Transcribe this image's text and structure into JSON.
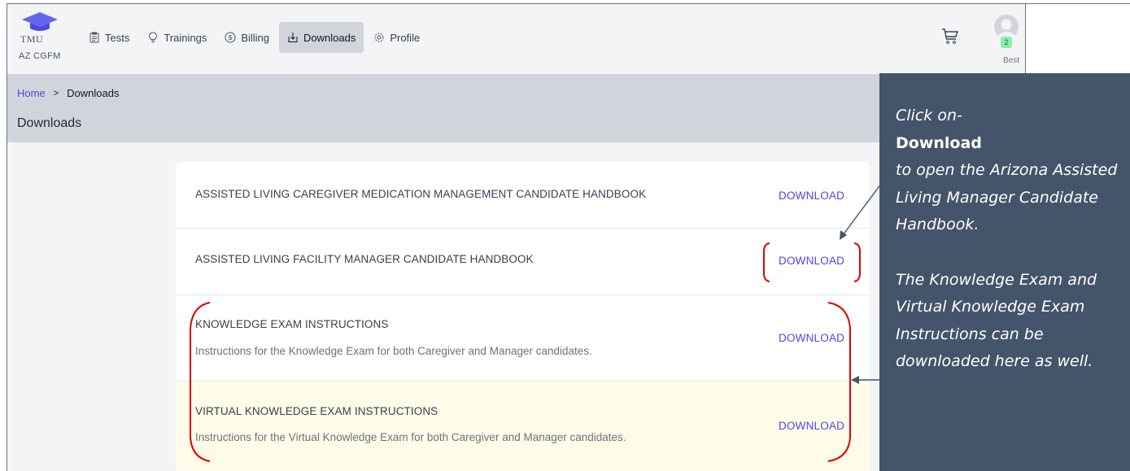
{
  "app": {
    "logo_text": "TMU",
    "logo_sub": "AZ CGFM"
  },
  "nav": {
    "items": [
      {
        "label": "Tests",
        "icon": "clipboard-icon",
        "active": false
      },
      {
        "label": "Trainings",
        "icon": "lightbulb-icon",
        "active": false
      },
      {
        "label": "Billing",
        "icon": "dollar-circle-icon",
        "active": false
      },
      {
        "label": "Downloads",
        "icon": "download-tray-icon",
        "active": true
      },
      {
        "label": "Profile",
        "icon": "gear-icon",
        "active": false
      }
    ]
  },
  "user": {
    "badge_count": "2",
    "name": "Best"
  },
  "breadcrumb": {
    "home": "Home",
    "separator": ">",
    "current": "Downloads"
  },
  "page": {
    "title": "Downloads"
  },
  "downloads": [
    {
      "title": "ASSISTED LIVING CAREGIVER MEDICATION MANAGEMENT CANDIDATE HANDBOOK",
      "desc": "",
      "action": "DOWNLOAD"
    },
    {
      "title": "ASSISTED LIVING FACILITY MANAGER CANDIDATE HANDBOOK",
      "desc": "",
      "action": "DOWNLOAD"
    },
    {
      "title": "KNOWLEDGE EXAM INSTRUCTIONS",
      "desc": "Instructions for the Knowledge Exam for both Caregiver and Manager candidates.",
      "action": "DOWNLOAD"
    },
    {
      "title": "VIRTUAL KNOWLEDGE EXAM INSTRUCTIONS",
      "desc": "Instructions for the Virtual Knowledge Exam for both Caregiver and Manager candidates.",
      "action": "DOWNLOAD"
    }
  ],
  "annotation": {
    "line1": "Click on-",
    "line2": "Download",
    "line3": "to open the Arizona Assisted Living Manager Candidate Handbook.",
    "line4": "The Knowledge Exam and Virtual Knowledge Exam Instructions can be downloaded here as well."
  },
  "colors": {
    "accent": "#4f46e5",
    "annotation_bg": "#44546a",
    "highlight_row": "#fefce8",
    "bracket_red": "#e00000"
  }
}
